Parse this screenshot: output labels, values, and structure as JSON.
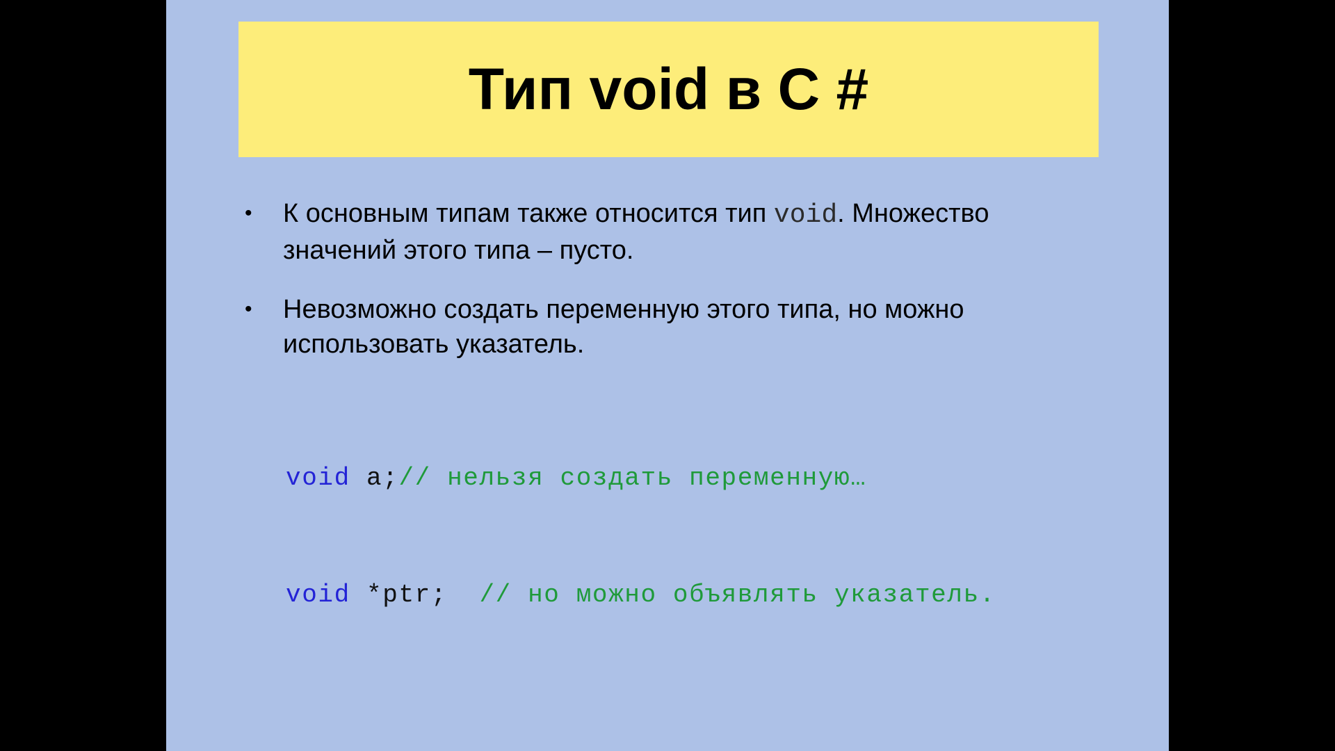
{
  "slide": {
    "title": "Тип void в C #",
    "bullets": [
      {
        "marker": "•",
        "text_before": "К основным типам также относится тип ",
        "code_word": "void",
        "text_after": ". Множество значений этого типа – пусто."
      },
      {
        "marker": "•",
        "text": "Невозможно создать переменную этого типа, но можно использовать указатель."
      }
    ],
    "code": [
      {
        "keyword": "void",
        "statement": " a;",
        "comment": "// нельзя создать переменную…"
      },
      {
        "keyword": "void",
        "statement": " *ptr;  ",
        "comment": "// но можно объявлять указатель."
      }
    ]
  },
  "colors": {
    "background": "#000000",
    "slide_background": "#adc1e7",
    "title_background": "#fded7a",
    "keyword": "#2323d6",
    "comment": "#1f9a3a"
  }
}
